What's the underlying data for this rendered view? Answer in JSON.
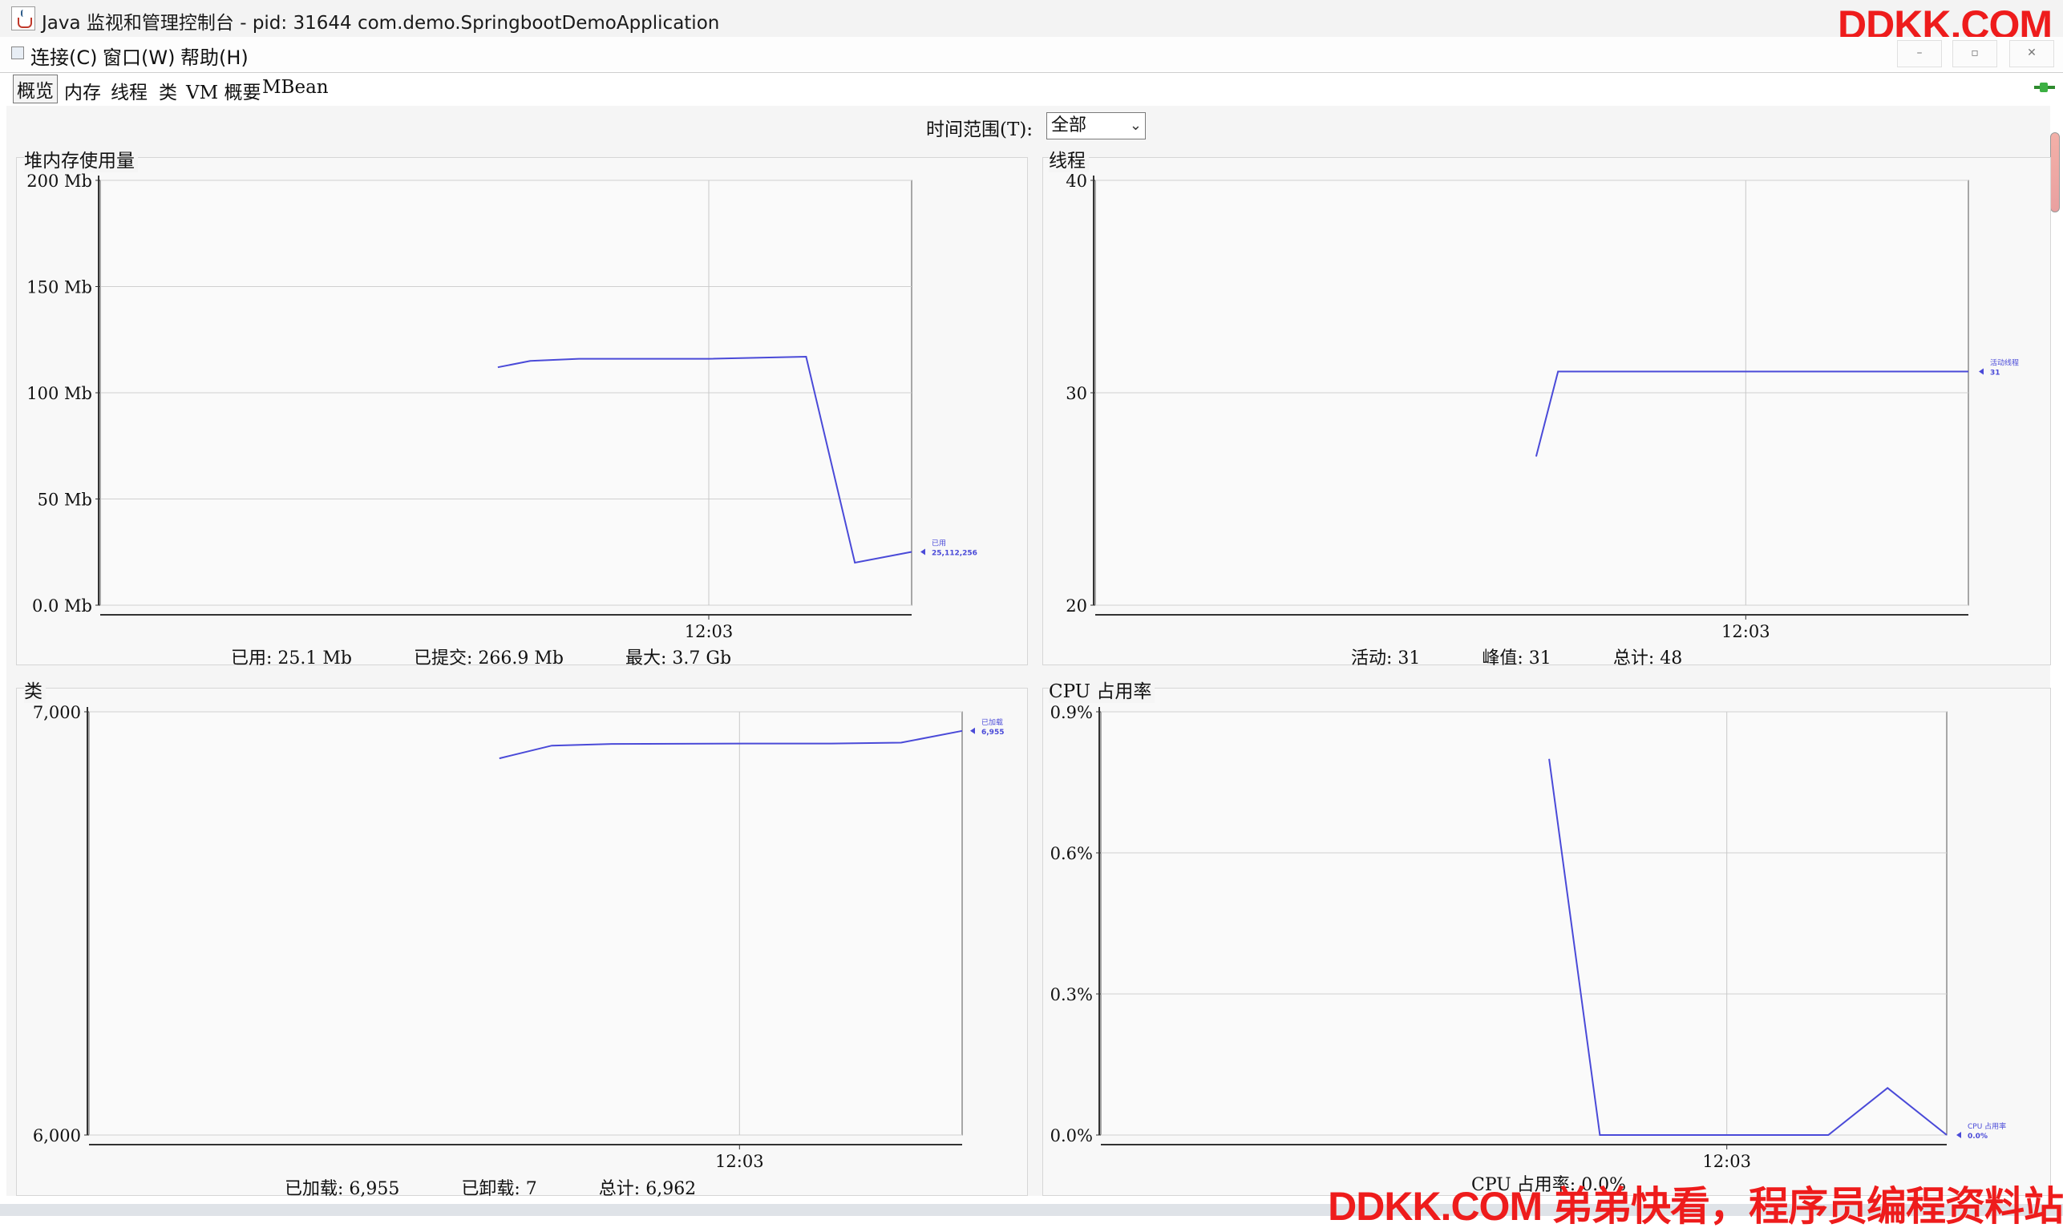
{
  "window": {
    "title": "Java 监视和管理控制台 - pid: 31644 com.demo.SpringbootDemoApplication",
    "icon": "java-coffee-icon",
    "buttons": {
      "minimize": "–",
      "restore": "▫",
      "close": "✕"
    }
  },
  "watermark": {
    "top": "DDKK.COM",
    "bottom": "DDKK.COM 弟弟快看，程序员编程资料站"
  },
  "menu": {
    "items": [
      {
        "label": "连接(C)"
      },
      {
        "label": "窗口(W)"
      },
      {
        "label": "帮助(H)"
      }
    ]
  },
  "tabs": [
    {
      "label": "概览",
      "active": true
    },
    {
      "label": "内存"
    },
    {
      "label": "线程"
    },
    {
      "label": "类"
    },
    {
      "label": "VM 概要"
    },
    {
      "label": "MBean"
    }
  ],
  "time_range": {
    "label": "时间范围(T):",
    "value": "全部"
  },
  "colors": {
    "line": "#4a4ad8",
    "grid": "#d4d4d4",
    "axis": "#333333",
    "watermark": "#ee1c1c"
  },
  "panels": {
    "heap": {
      "title": "堆内存使用量",
      "legend": {
        "name": "已用",
        "value": "25,112,256"
      },
      "summary": {
        "used": "已用:  25.1  Mb",
        "committed": "已提交:  266.9  Mb",
        "max": "最大:  3.7  Gb"
      }
    },
    "threads": {
      "title": "线程",
      "legend": {
        "name": "活动线程",
        "value": "31"
      },
      "summary": {
        "live": "活动:  31",
        "peak": "峰值:  31",
        "total": "总计:  48"
      }
    },
    "classes": {
      "title": "类",
      "legend": {
        "name": "已加载",
        "value": "6,955"
      },
      "summary": {
        "loaded": "已加载:  6,955",
        "unloaded": "已卸载:  7",
        "total": "总计:  6,962"
      }
    },
    "cpu": {
      "title": "CPU 占用率",
      "legend": {
        "name": "CPU 占用率",
        "value": "0.0%"
      },
      "summary": {
        "usage": "CPU 占用率:  0.0%"
      }
    }
  },
  "chart_data": [
    {
      "type": "line",
      "title": "堆内存使用量",
      "y_ticks": [
        "0.0 Mb",
        "50 Mb",
        "100 Mb",
        "150 Mb",
        "200 Mb"
      ],
      "ylim": [
        0,
        200
      ],
      "x_tick": "12:03",
      "x_tick_pos": 0.75,
      "series": [
        {
          "name": "已用",
          "x": [
            0.49,
            0.53,
            0.59,
            0.75,
            0.87,
            0.93,
            1.0
          ],
          "values": [
            112,
            115,
            116,
            116,
            117,
            20,
            25.1
          ]
        }
      ]
    },
    {
      "type": "line",
      "title": "线程",
      "y_ticks": [
        "20",
        "30",
        "40"
      ],
      "ylim": [
        20,
        40
      ],
      "x_tick": "12:03",
      "x_tick_pos": 0.745,
      "series": [
        {
          "name": "活动线程",
          "x": [
            0.505,
            0.53,
            1.0
          ],
          "values": [
            27,
            31,
            31
          ]
        }
      ]
    },
    {
      "type": "line",
      "title": "类",
      "y_ticks": [
        "6,000",
        "7,000"
      ],
      "ylim": [
        6000,
        7000
      ],
      "x_tick": "12:03",
      "x_tick_pos": 0.745,
      "series": [
        {
          "name": "已加载",
          "x": [
            0.47,
            0.53,
            0.6,
            0.75,
            0.85,
            0.93,
            1.0
          ],
          "values": [
            6890,
            6920,
            6924,
            6925,
            6925,
            6927,
            6955
          ]
        }
      ]
    },
    {
      "type": "line",
      "title": "CPU 占用率",
      "y_ticks": [
        "0.0%",
        "0.3%",
        "0.6%",
        "0.9%"
      ],
      "ylim": [
        0,
        0.9
      ],
      "x_tick": "12:03",
      "x_tick_pos": 0.74,
      "series": [
        {
          "name": "CPU 占用率",
          "x": [
            0.53,
            0.59,
            0.86,
            0.93,
            1.0
          ],
          "values": [
            0.8,
            0.0,
            0.0,
            0.1,
            0.0
          ]
        }
      ]
    }
  ]
}
